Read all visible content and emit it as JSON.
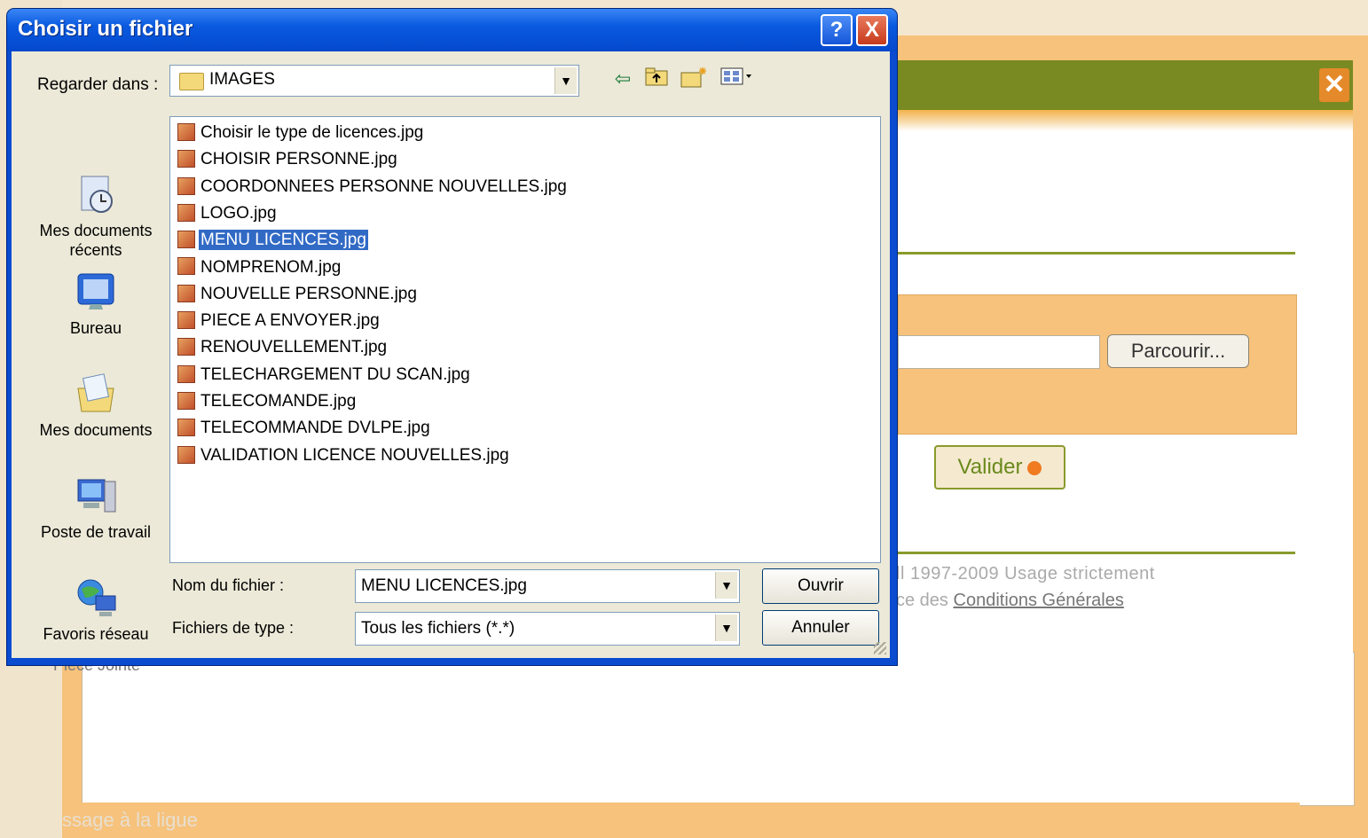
{
  "dialog": {
    "title": "Choisir un fichier",
    "look_in_label": "Regarder dans :",
    "look_in_value": "IMAGES",
    "places": [
      {
        "label": "Mes documents récents",
        "icon": "recent-documents-icon"
      },
      {
        "label": "Bureau",
        "icon": "desktop-icon"
      },
      {
        "label": "Mes documents",
        "icon": "my-documents-icon"
      },
      {
        "label": "Poste de travail",
        "icon": "my-computer-icon"
      },
      {
        "label": "Favoris réseau",
        "icon": "network-places-icon"
      }
    ],
    "files": [
      "Choisir le type de licences.jpg",
      "CHOISIR PERSONNE.jpg",
      "COORDONNEES PERSONNE NOUVELLES.jpg",
      "LOGO.jpg",
      "MENU LICENCES.jpg",
      "NOMPRENOM.jpg",
      "NOUVELLE PERSONNE.jpg",
      "PIECE A ENVOYER.jpg",
      "RENOUVELLEMENT.jpg",
      "TELECHARGEMENT DU SCAN.jpg",
      "TELECOMANDE.jpg",
      "TELECOMMANDE DVLPE.jpg",
      "VALIDATION LICENCE NOUVELLES.jpg"
    ],
    "selected_file": "MENU LICENCES.jpg",
    "filename_label": "Nom du fichier :",
    "filename_value": "MENU LICENCES.jpg",
    "filetype_label": "Fichiers de type :",
    "filetype_value": "Tous les fichiers (*.*)",
    "open_label": "Ouvrir",
    "cancel_label": "Annuler",
    "help_glyph": "?",
    "close_glyph": "X"
  },
  "web": {
    "close_glyph": "✕",
    "browse_label": "Parcourir...",
    "submit_label": "Valider",
    "copyright_line": "ll 1997-2009 Usage strictement",
    "terms_prefix": "ce des",
    "terms_link": "Conditions Générales",
    "footer_text": "ssage à la ligue",
    "under_dialog_text": "Pièce Jointe"
  },
  "colors": {
    "xp_title_blue": "#0a5ae0",
    "web_orange": "#f6c27c",
    "web_green": "#7a8a22",
    "selection_blue": "#316ac5"
  }
}
